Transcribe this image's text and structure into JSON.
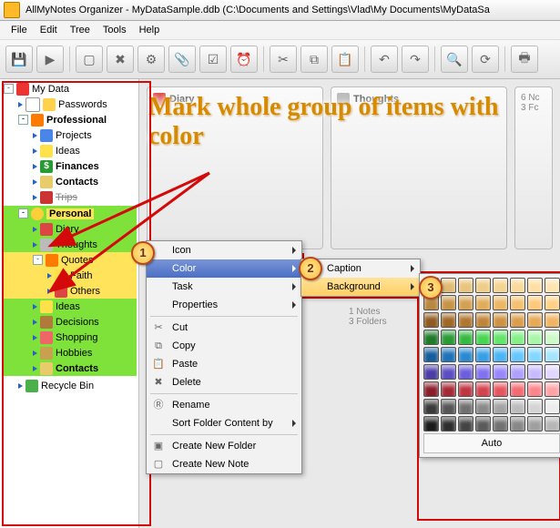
{
  "title": "AllMyNotes Organizer - MyDataSample.ddb (C:\\Documents and Settings\\Vlad\\My Documents\\MyDataSa",
  "menu": [
    "File",
    "Edit",
    "Tree",
    "Tools",
    "Help"
  ],
  "callout": "Mark whole group of items with color",
  "tree": {
    "root": "My Data",
    "passwords": "Passwords",
    "professional": "Professional",
    "prof_items": [
      "Projects",
      "Ideas",
      "Finances",
      "Contacts",
      "Trips"
    ],
    "personal": "Personal",
    "pers_items": [
      "Diary",
      "Thoughts",
      "Quotes",
      "Ideas",
      "Decisions",
      "Shopping",
      "Hobbies",
      "Contacts"
    ],
    "quotes_children": [
      "Faith",
      "Others"
    ],
    "recycle": "Recycle Bin"
  },
  "cards": {
    "c1": "Diary",
    "c2": "Thoughts",
    "c3a": "6 Nc",
    "c3b": "3 Fc",
    "info1": "1 Notes",
    "info2": "3 Folders"
  },
  "ctx": {
    "icon": "Icon",
    "color": "Color",
    "task": "Task",
    "props": "Properties",
    "cut": "Cut",
    "copy": "Copy",
    "paste": "Paste",
    "delete": "Delete",
    "rename": "Rename",
    "sort": "Sort Folder Content by",
    "newf": "Create New Folder",
    "newn": "Create New Note"
  },
  "sub": {
    "caption": "Caption",
    "background": "Background"
  },
  "palette_auto": "Auto",
  "badges": {
    "b1": "1",
    "b2": "2",
    "b3": "3"
  },
  "palette": [
    [
      "#d7b26a",
      "#e0bb73",
      "#e8c47d",
      "#efcc87",
      "#f5d391",
      "#fad99b",
      "#fddfa5",
      "#ffe5af"
    ],
    [
      "#b9883e",
      "#c79447",
      "#d4a051",
      "#e0ac5b",
      "#ebb766",
      "#f4c171",
      "#fcc97c",
      "#ffd187"
    ],
    [
      "#8f5a1f",
      "#a06827",
      "#b07630",
      "#bf8439",
      "#cd9143",
      "#da9d4d",
      "#e5a958",
      "#efb463"
    ],
    [
      "#1f7a2a",
      "#2a9a36",
      "#35b942",
      "#47d552",
      "#63e46a",
      "#85ef88",
      "#a9f6a8",
      "#cdfac8"
    ],
    [
      "#145c9c",
      "#1e72b8",
      "#2a89d1",
      "#389fe6",
      "#4bb4f4",
      "#65c7fc",
      "#84d7ff",
      "#a7e4ff"
    ],
    [
      "#4a3da6",
      "#5b4dc2",
      "#6d5edb",
      "#8171ef",
      "#9787fb",
      "#af9fff",
      "#c8baff",
      "#e1d6ff"
    ],
    [
      "#8a1d2a",
      "#a52835",
      "#be3441",
      "#d4424e",
      "#e6545e",
      "#f36a72",
      "#fb858b",
      "#ffa3a7"
    ],
    [
      "#3a3a3a",
      "#555",
      "#707070",
      "#8a8a8a",
      "#a3a3a3",
      "#bcbcbc",
      "#d4d4d4",
      "#ececec"
    ],
    [
      "#1a1a1a",
      "#2e2e2e",
      "#444",
      "#5a5a5a",
      "#717171",
      "#888",
      "#9f9f9f",
      "#b6b6b6"
    ]
  ]
}
